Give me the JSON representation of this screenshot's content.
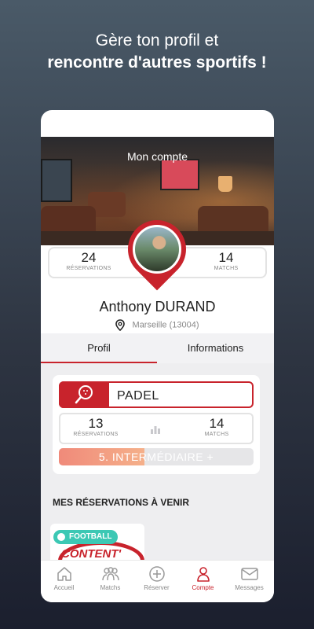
{
  "promo": {
    "line1": "Gère ton profil et",
    "line2": "rencontre d'autres sportifs !"
  },
  "header": {
    "title": "Mon compte"
  },
  "profile": {
    "reservations_count": "24",
    "reservations_label": "RÉSERVATIONS",
    "matchs_count": "14",
    "matchs_label": "MATCHS",
    "first_name": "Anthony",
    "last_name": "DURAND",
    "location": "Marseille (13004)"
  },
  "tabs": [
    {
      "label": "Profil",
      "active": true
    },
    {
      "label": "Informations",
      "active": false
    }
  ],
  "sport": {
    "name": "PADEL",
    "icon": "padel-racket-icon",
    "reservations_count": "13",
    "reservations_label": "RÉSERVATIONS",
    "matchs_count": "14",
    "matchs_label": "MATCHS",
    "level_label": "5. INTERMÉDIAIRE +",
    "level_progress": 0.44
  },
  "upcoming": {
    "title": "MES RÉSERVATIONS À VENIR",
    "cards": [
      {
        "badge": "FOOTBALL",
        "art_text": "CONTENT'"
      }
    ]
  },
  "bottom_nav": [
    {
      "label": "Accueil",
      "icon": "home-icon",
      "active": false
    },
    {
      "label": "Matchs",
      "icon": "group-icon",
      "active": false
    },
    {
      "label": "Réserver",
      "icon": "plus-circle-icon",
      "active": false
    },
    {
      "label": "Compte",
      "icon": "user-icon",
      "active": true
    },
    {
      "label": "Messages",
      "icon": "mail-icon",
      "active": false
    }
  ],
  "colors": {
    "brand_red": "#c8232c",
    "badge_teal": "#3cc8b4",
    "level_gradient_start": "#f08a7a"
  }
}
